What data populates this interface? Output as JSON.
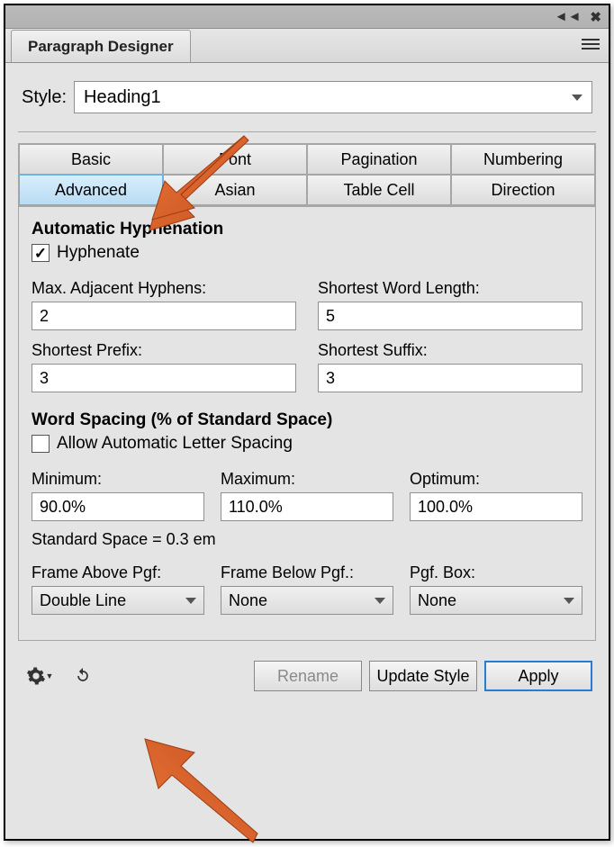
{
  "titlebar": {
    "panel_title": "Paragraph Designer"
  },
  "style": {
    "label": "Style:",
    "value": "Heading1"
  },
  "categories": {
    "row1": [
      "Basic",
      "Font",
      "Pagination",
      "Numbering"
    ],
    "row2": [
      "Advanced",
      "Asian",
      "Table Cell",
      "Direction"
    ],
    "active": "Advanced"
  },
  "hyphenation": {
    "title": "Automatic Hyphenation",
    "hyphenate_label": "Hyphenate",
    "hyphenate_checked": true,
    "max_adj_label": "Max. Adjacent Hyphens:",
    "max_adj_value": "2",
    "short_word_label": "Shortest Word Length:",
    "short_word_value": "5",
    "short_prefix_label": "Shortest Prefix:",
    "short_prefix_value": "3",
    "short_suffix_label": "Shortest Suffix:",
    "short_suffix_value": "3"
  },
  "spacing": {
    "title": "Word Spacing (% of Standard Space)",
    "allow_label": "Allow Automatic Letter Spacing",
    "allow_checked": false,
    "min_label": "Minimum:",
    "min_value": "90.0%",
    "max_label": "Maximum:",
    "max_value": "110.0%",
    "opt_label": "Optimum:",
    "opt_value": "100.0%",
    "std_space": "Standard Space = 0.3 em"
  },
  "frames": {
    "above_label": "Frame Above Pgf:",
    "above_value": "Double Line",
    "below_label": "Frame Below Pgf.:",
    "below_value": "None",
    "box_label": "Pgf. Box:",
    "box_value": "None"
  },
  "buttons": {
    "rename": "Rename",
    "update": "Update Style",
    "apply": "Apply"
  }
}
